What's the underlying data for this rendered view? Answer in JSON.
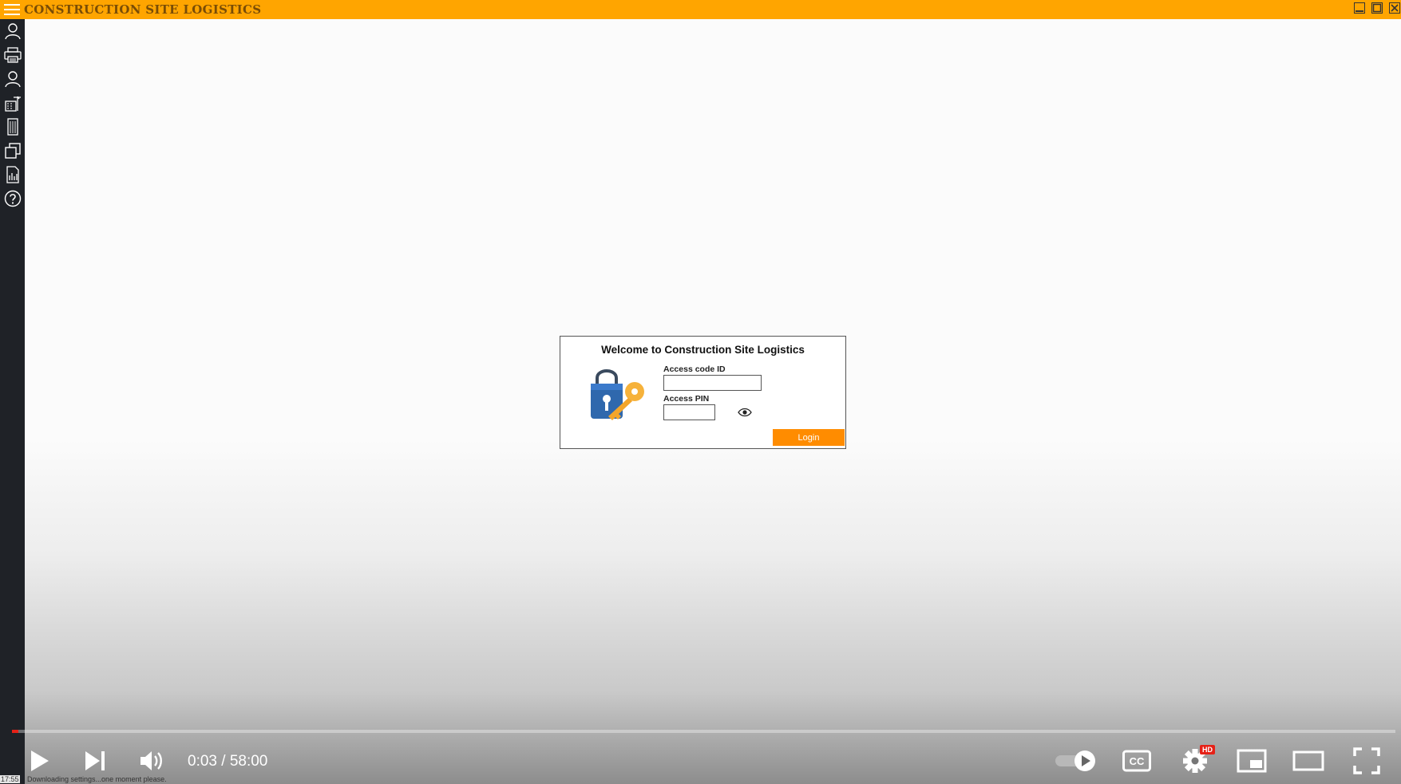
{
  "app": {
    "title": "CONSTRUCTION SITE LOGISTICS",
    "accent_color": "#ffa500",
    "title_color": "#7a4d06"
  },
  "window_controls": [
    "minimize-icon",
    "maximize-icon",
    "close-icon"
  ],
  "sidebar": {
    "items": [
      {
        "icon": "user-icon"
      },
      {
        "icon": "printer-icon"
      },
      {
        "icon": "user-icon"
      },
      {
        "icon": "crane-building-icon"
      },
      {
        "icon": "building-icon"
      },
      {
        "icon": "copy-icon"
      },
      {
        "icon": "report-chart-icon"
      },
      {
        "icon": "help-icon"
      }
    ]
  },
  "login": {
    "title": "Welcome to Construction Site Logistics",
    "access_code_label": "Access code ID",
    "access_code_value": "",
    "access_pin_label": "Access PIN",
    "access_pin_value": "",
    "login_label": "Login",
    "login_color": "#ff8c00"
  },
  "player": {
    "time": "0:03 / 58:00",
    "progress_fraction": 0.0009,
    "hd_badge": "HD",
    "progress_color": "#e62117"
  },
  "status": {
    "clock": "17:55",
    "message": "Downloading settings...one moment please."
  }
}
